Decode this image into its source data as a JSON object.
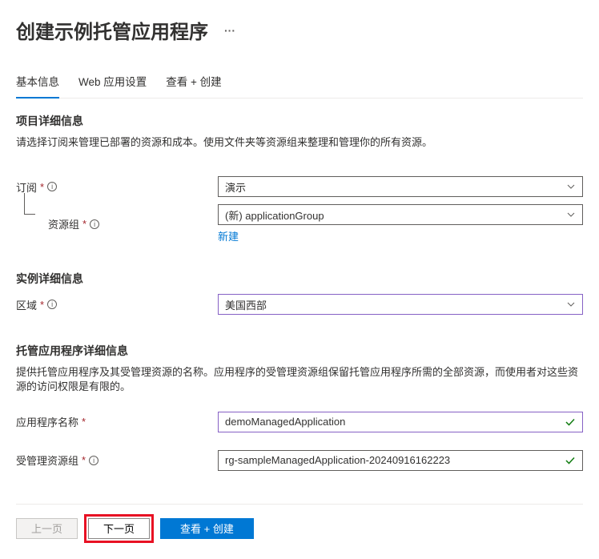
{
  "header": {
    "title": "创建示例托管应用程序",
    "more": "···"
  },
  "tabs": [
    {
      "label": "基本信息",
      "active": true
    },
    {
      "label": "Web 应用设置",
      "active": false
    },
    {
      "label": "查看 + 创建",
      "active": false
    }
  ],
  "sections": {
    "project": {
      "title": "项目详细信息",
      "desc": "请选择订阅来管理已部署的资源和成本。使用文件夹等资源组来整理和管理你的所有资源。",
      "subscription": {
        "label": "订阅",
        "value": "演示"
      },
      "resourceGroup": {
        "label": "资源组",
        "value": "(新) applicationGroup",
        "newLink": "新建"
      }
    },
    "instance": {
      "title": "实例详细信息",
      "region": {
        "label": "区域",
        "value": "美国西部"
      }
    },
    "managed": {
      "title": "托管应用程序详细信息",
      "desc": "提供托管应用程序及其受管理资源的名称。应用程序的受管理资源组保留托管应用程序所需的全部资源，而使用者对这些资源的访问权限是有限的。",
      "appName": {
        "label": "应用程序名称",
        "value": "demoManagedApplication"
      },
      "managedRg": {
        "label": "受管理资源组",
        "value": "rg-sampleManagedApplication-20240916162223"
      }
    }
  },
  "footer": {
    "prev": "上一页",
    "next": "下一页",
    "review": "查看 + 创建"
  }
}
